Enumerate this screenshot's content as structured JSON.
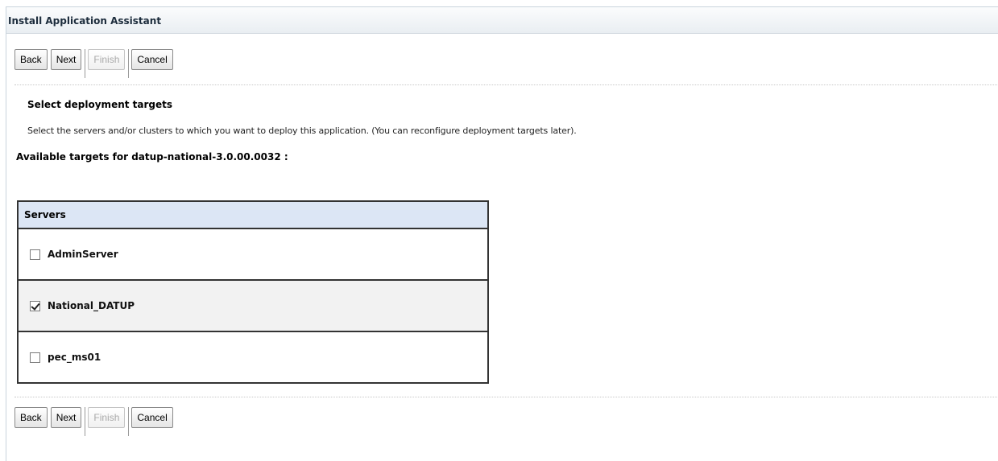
{
  "window": {
    "title": "Install Application Assistant"
  },
  "buttons": {
    "back": "Back",
    "next": "Next",
    "finish": "Finish",
    "cancel": "Cancel"
  },
  "section": {
    "heading": "Select deployment targets",
    "description": "Select the servers and/or clusters to which you want to deploy this application. (You can reconfigure deployment targets later).",
    "available_label": "Available targets for datup-national-3.0.00.0032 :"
  },
  "servers_table": {
    "header": "Servers",
    "rows": [
      {
        "label": "AdminServer",
        "checked": false
      },
      {
        "label": "National_DATUP",
        "checked": true
      },
      {
        "label": "pec_ms01",
        "checked": false
      }
    ]
  },
  "colors": {
    "table_header_bg": "#dce6f5",
    "title_text": "#1c2c3c",
    "disabled_text": "#a9a9a9"
  }
}
